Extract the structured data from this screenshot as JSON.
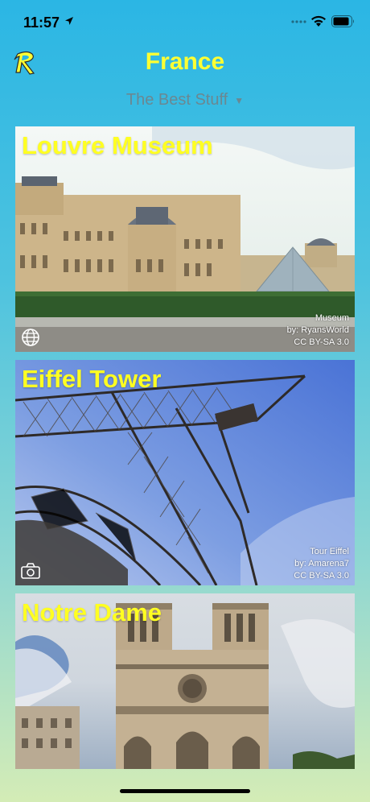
{
  "status_bar": {
    "time": "11:57"
  },
  "header": {
    "title": "France",
    "subtitle": "The Best Stuff"
  },
  "cards": [
    {
      "name": "Louvre Museum",
      "credit_lines": [
        "Museum",
        "by: RyansWorld",
        "CC BY-SA 3.0"
      ],
      "icon": "globe-icon"
    },
    {
      "name": "Eiffel Tower",
      "credit_lines": [
        "Tour Eiffel",
        "by: Amarena7",
        "CC BY-SA 3.0"
      ],
      "icon": "camera-icon"
    },
    {
      "name": "Notre Dame"
    }
  ],
  "colors": {
    "title": "#ffff33",
    "subtitle": "#6a8892",
    "card_title": "#ffff22"
  }
}
